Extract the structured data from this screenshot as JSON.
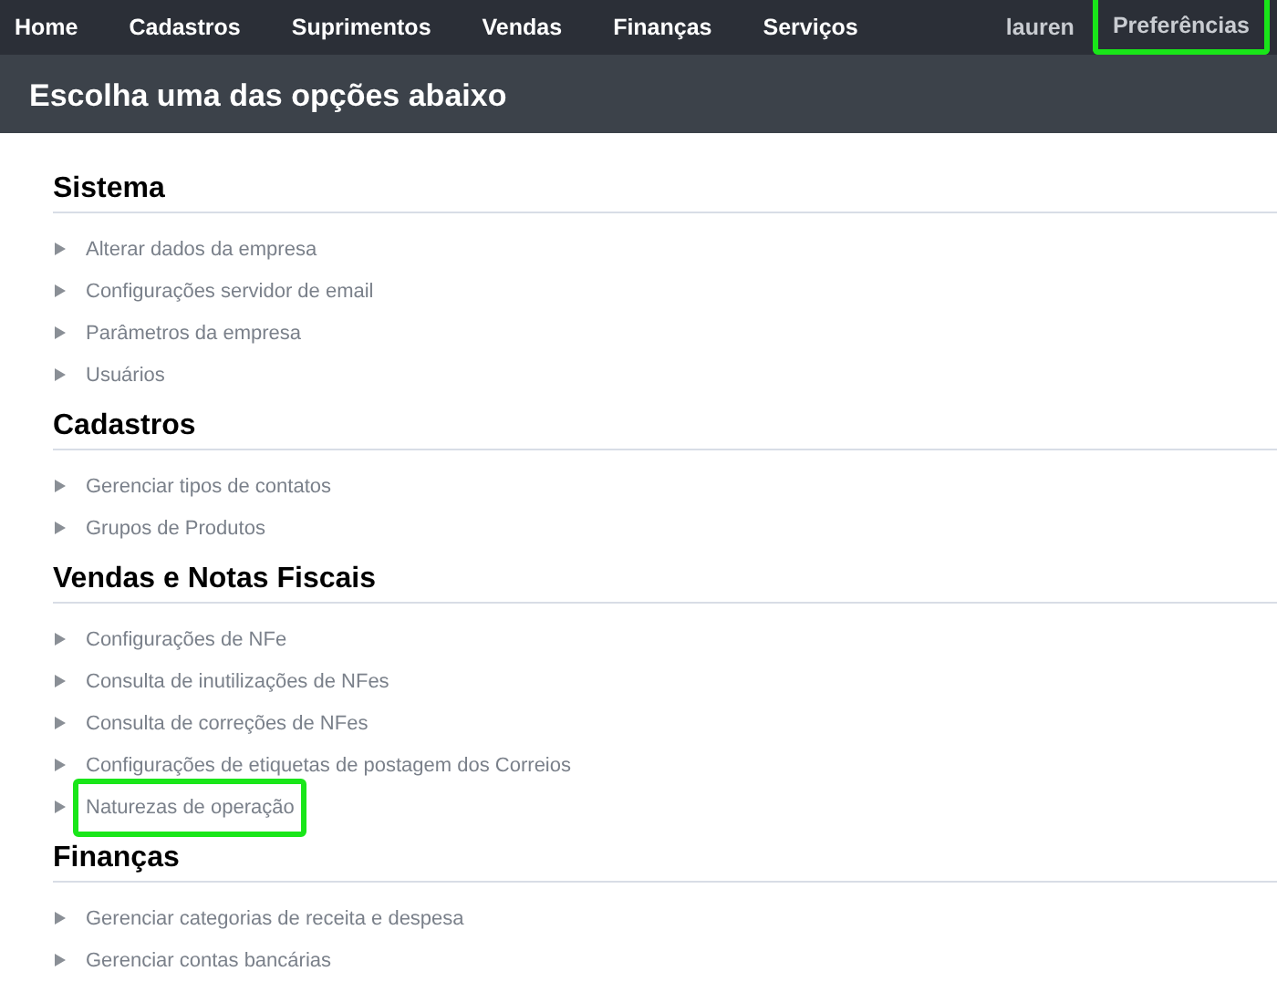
{
  "nav": {
    "items": [
      {
        "label": "Home"
      },
      {
        "label": "Cadastros"
      },
      {
        "label": "Suprimentos"
      },
      {
        "label": "Vendas"
      },
      {
        "label": "Finanças"
      },
      {
        "label": "Serviços"
      }
    ],
    "user": "lauren",
    "preferences": {
      "label": "Preferências",
      "highlighted": true
    }
  },
  "page_title": "Escolha uma das opções abaixo",
  "sections": [
    {
      "title": "Sistema",
      "items": [
        {
          "label": "Alterar dados da empresa",
          "highlighted": false
        },
        {
          "label": "Configurações servidor de email",
          "highlighted": false
        },
        {
          "label": "Parâmetros da empresa",
          "highlighted": false
        },
        {
          "label": "Usuários",
          "highlighted": false
        }
      ]
    },
    {
      "title": "Cadastros",
      "items": [
        {
          "label": "Gerenciar tipos de contatos",
          "highlighted": false
        },
        {
          "label": "Grupos de Produtos",
          "highlighted": false
        }
      ]
    },
    {
      "title": "Vendas e Notas Fiscais",
      "items": [
        {
          "label": "Configurações de NFe",
          "highlighted": false
        },
        {
          "label": "Consulta de inutilizações de NFes",
          "highlighted": false
        },
        {
          "label": "Consulta de correções de NFes",
          "highlighted": false
        },
        {
          "label": "Configurações de etiquetas de postagem dos Correios",
          "highlighted": false
        },
        {
          "label": "Naturezas de operação",
          "highlighted": true
        }
      ]
    },
    {
      "title": "Finanças",
      "items": [
        {
          "label": "Gerenciar categorias de receita e despesa",
          "highlighted": false
        },
        {
          "label": "Gerenciar contas bancárias",
          "highlighted": false
        }
      ]
    }
  ]
}
